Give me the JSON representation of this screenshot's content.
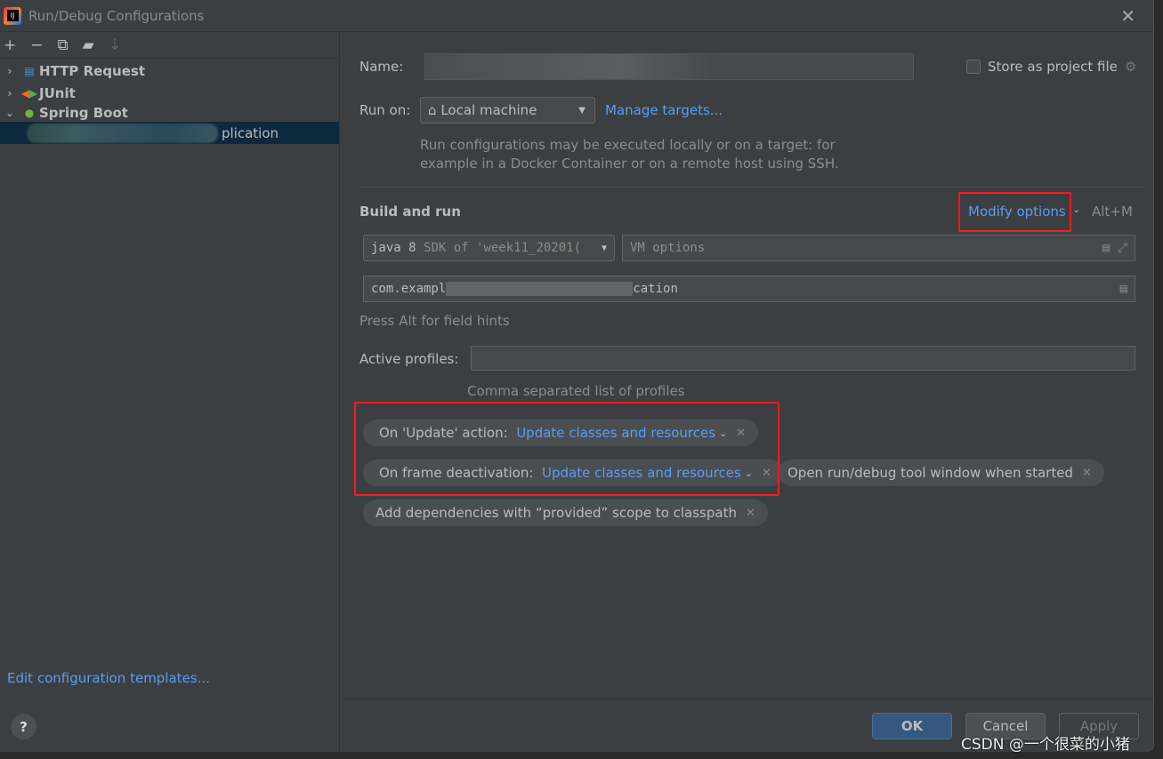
{
  "window": {
    "title": "Run/Debug Configurations",
    "logo": "IJ"
  },
  "toolbar": {
    "icons": [
      "plus-icon",
      "minus-icon",
      "copy-icon",
      "folder-add-icon",
      "sort-az-icon"
    ]
  },
  "tree": {
    "items": [
      {
        "label": "HTTP Request",
        "expanded": false
      },
      {
        "label": "JUnit",
        "expanded": false
      },
      {
        "label": "Spring Boot",
        "expanded": true
      }
    ],
    "selected_suffix": "plication"
  },
  "left_footer": {
    "templates_link": "Edit configuration templates..."
  },
  "form": {
    "name_label": "Name:",
    "store_label": "Store as project file",
    "store_checked": false,
    "run_on_label": "Run on:",
    "run_on_value": "Local machine",
    "manage_targets": "Manage targets...",
    "run_hint_1": "Run configurations may be executed locally or on a target: for",
    "run_hint_2": "example in a Docker Container or on a remote host using SSH.",
    "build_run": "Build and run",
    "modify_options": "Modify options",
    "modify_shortcut": "Alt+M",
    "jdk_value": "java 8",
    "jdk_detail": "SDK of 'week11_20201(",
    "vm_placeholder": "VM options",
    "main_class_prefix": "com.exampl",
    "main_class_suffix": "cation",
    "field_hint": "Press Alt for field hints",
    "profiles_label": "Active profiles:",
    "profiles_value": "",
    "profiles_hint": "Comma separated list of profiles"
  },
  "chips": [
    {
      "label": "On 'Update' action:",
      "value": "Update classes and resources"
    },
    {
      "label": "On frame deactivation:",
      "value": "Update classes and resources"
    },
    {
      "label": "Open run/debug tool window when started"
    },
    {
      "label": "Add dependencies with “provided” scope to classpath"
    }
  ],
  "buttons": {
    "ok": "OK",
    "cancel": "Cancel",
    "apply": "Apply"
  },
  "watermark": "CSDN @一个很菜的小猪",
  "colors": {
    "accent": "#589df6",
    "highlight": "#ff1a1a",
    "ok": "#365880"
  }
}
